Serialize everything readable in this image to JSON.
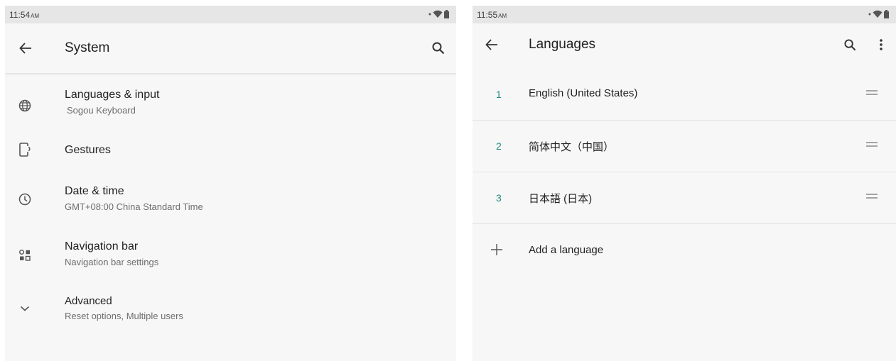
{
  "left": {
    "status": {
      "time": "11:54",
      "ampm": "AM"
    },
    "header": {
      "title": "System"
    },
    "items": [
      {
        "title": "Languages & input",
        "subtitle": "Sogou Keyboard",
        "icon": "globe-icon"
      },
      {
        "title": "Gestures",
        "subtitle": "",
        "icon": "gestures-phone-icon"
      },
      {
        "title": "Date & time",
        "subtitle": "GMT+08:00 China Standard Time",
        "icon": "clock-icon"
      },
      {
        "title": "Navigation bar",
        "subtitle": "Navigation bar settings",
        "icon": "navigation-bar-icon"
      },
      {
        "title": "Advanced",
        "subtitle": "Reset options, Multiple users",
        "icon": "chevron-down-icon"
      }
    ]
  },
  "right": {
    "status": {
      "time": "11:55",
      "ampm": "AM"
    },
    "header": {
      "title": "Languages"
    },
    "languages": [
      {
        "index": "1",
        "name": "English (United States)"
      },
      {
        "index": "2",
        "name": "简体中文（中国）"
      },
      {
        "index": "3",
        "name": "日本語 (日本)"
      }
    ],
    "add_label": "Add a language"
  },
  "colors": {
    "accent": "#1f8a80",
    "text": "#222222",
    "subtext": "#6d6d6d",
    "statusbar": "#e6e6e6",
    "background": "#f7f7f7"
  }
}
